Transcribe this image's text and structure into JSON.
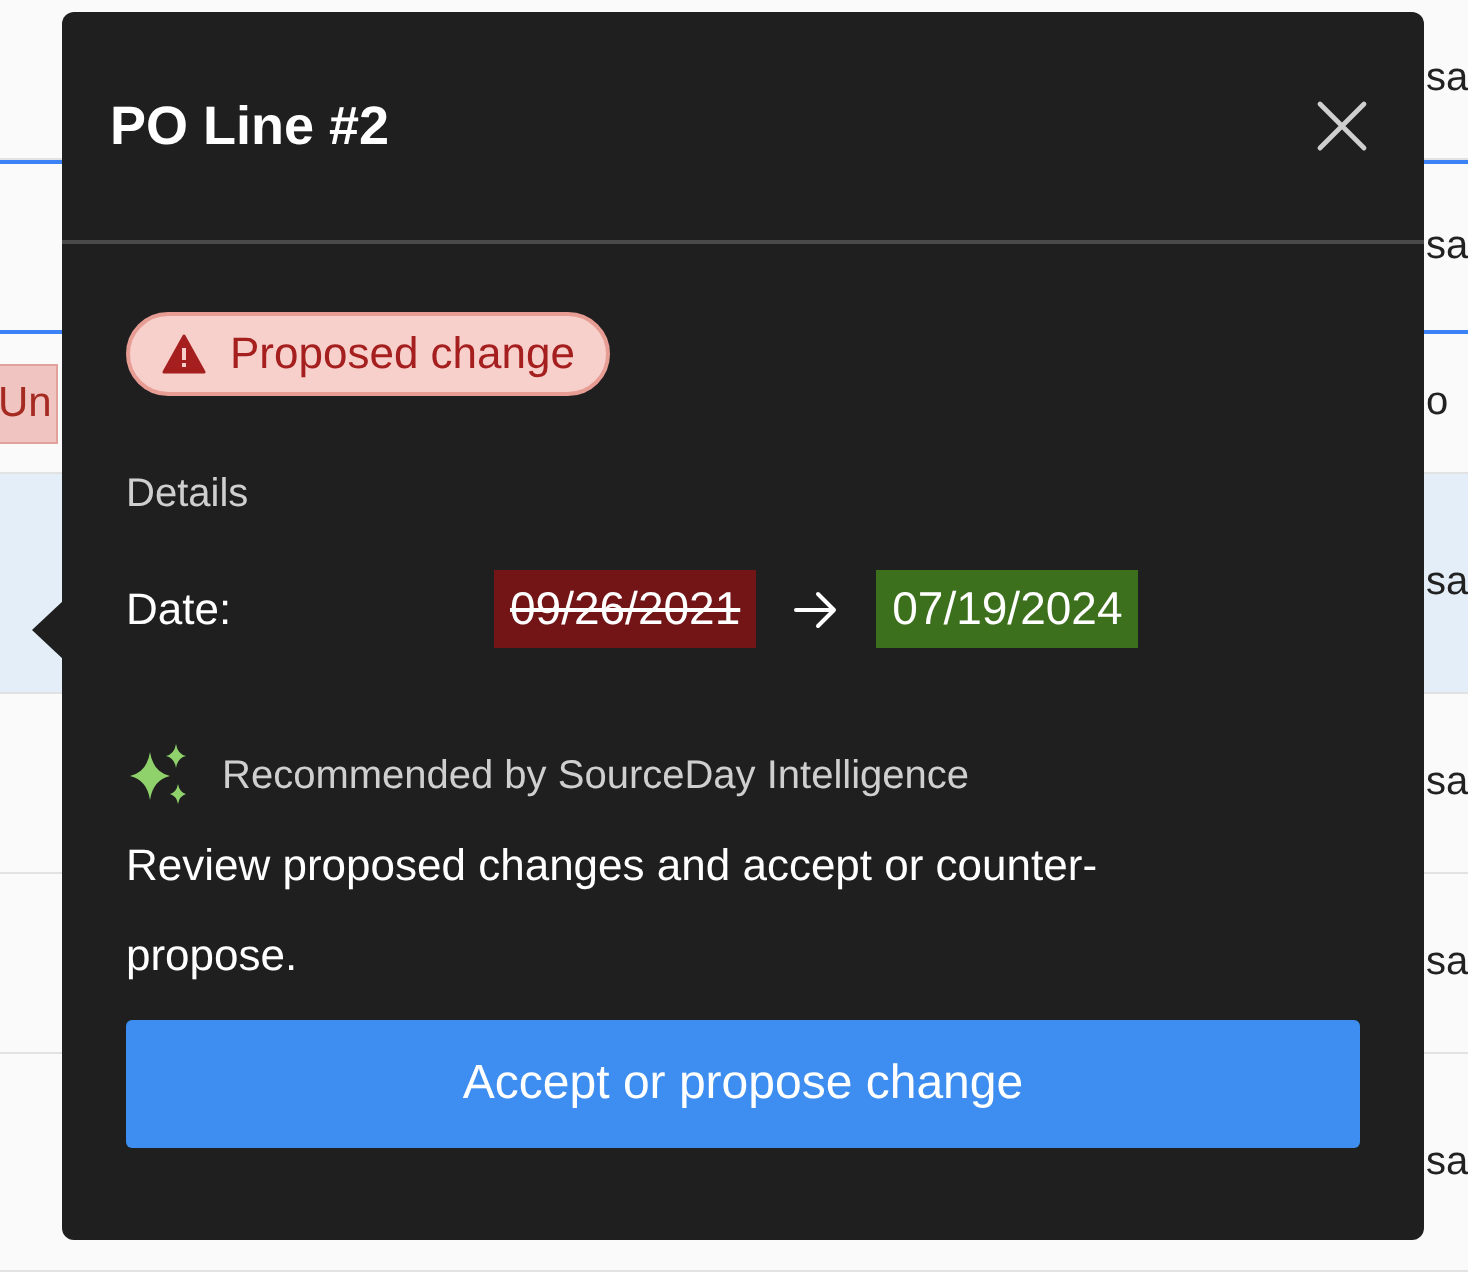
{
  "table": {
    "rows": [
      {
        "right_text": "sa",
        "selected": false,
        "highlighted": false
      },
      {
        "right_text": "sa",
        "selected": false,
        "highlighted": true
      },
      {
        "left_badge": "Un",
        "right_text": "o",
        "selected": false,
        "highlighted": false
      },
      {
        "right_text": "sa",
        "selected": true,
        "highlighted": false
      },
      {
        "right_text": "sa",
        "selected": false,
        "highlighted": false
      },
      {
        "right_text": "sa",
        "selected": false,
        "highlighted": false
      },
      {
        "right_text": "sa",
        "selected": false,
        "highlighted": false
      }
    ]
  },
  "popover": {
    "title": "PO Line #2",
    "status_badge": "Proposed change",
    "section_label": "Details",
    "changes": [
      {
        "label": "Date:",
        "old_value": "09/26/2021",
        "new_value": "07/19/2024"
      }
    ],
    "recommendation": "Recommended by SourceDay Intelligence",
    "message": "Review proposed changes and accept or counter-propose.",
    "action_button": "Accept or propose change"
  }
}
